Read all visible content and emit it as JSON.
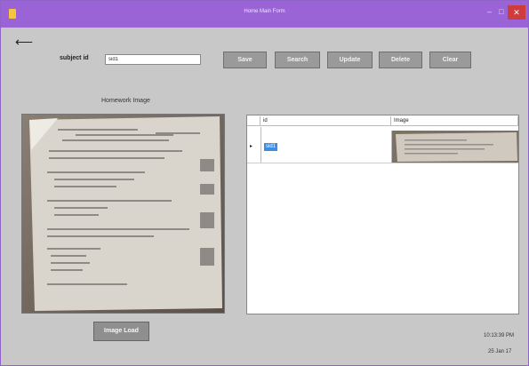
{
  "window": {
    "title": "Home Main Form",
    "minimize_glyph": "–",
    "maximize_glyph": "□",
    "close_glyph": "✕",
    "accent": "#9a63d6"
  },
  "back": {
    "glyph": "⟵"
  },
  "form": {
    "subject_label": "subject id",
    "subject_value": "sid1"
  },
  "toolbar": {
    "save_label": "Save",
    "search_label": "Search",
    "update_label": "Update",
    "delete_label": "Delete",
    "clear_label": "Clear"
  },
  "image_panel": {
    "heading": "Homework Image",
    "load_button_label": "Image Load"
  },
  "table": {
    "columns": [
      "id",
      "Image"
    ],
    "rows": [
      {
        "marker": "▸",
        "id": "sid1"
      }
    ]
  },
  "status": {
    "time": "10:13:39 PM",
    "date": "25 Jan 17"
  }
}
